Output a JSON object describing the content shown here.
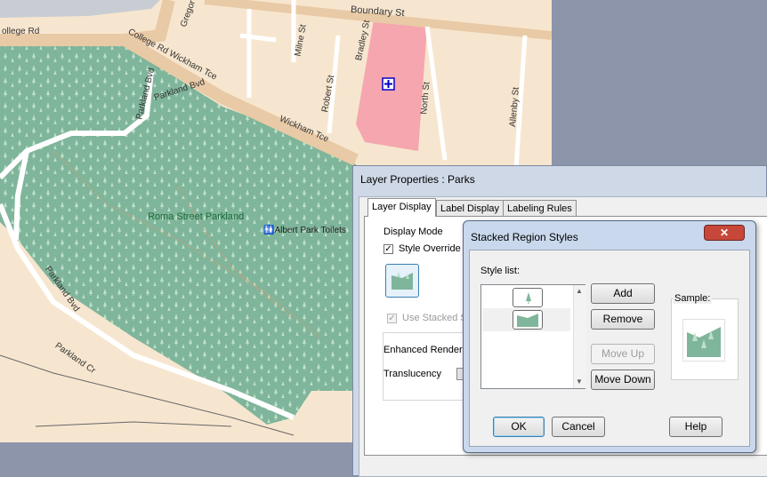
{
  "map": {
    "streets": {
      "boundary": "Boundary St",
      "gregory": "Gregor",
      "college_left": "ollege Rd",
      "college_wickham": "College Rd  Wickham Tce",
      "milne": "Milne St",
      "bradley": "Bradley St",
      "robert": "Robert St",
      "north": "North St",
      "allenby": "Allenby St",
      "parkland_bvd_upper": "Parkland Bvd",
      "parkland_bvd_lower": "Parkland Bvd",
      "wickham": "Wickham Tce",
      "parkland_cr": "Parkland Cr"
    },
    "park_name": "Roma Street Parkland",
    "toilets": "Albert Park Toilets",
    "colors": {
      "land": "#f7e6cf",
      "park": "#7fb59a",
      "hospital": "#f6a6ae",
      "road": "#f2d7b5"
    }
  },
  "layer_window": {
    "title": "Layer Properties  : Parks",
    "tabs": [
      "Layer Display",
      "Label Display",
      "Labeling Rules"
    ],
    "active_tab": "Layer Display",
    "display_mode_label": "Display Mode",
    "style_override_label": "Style Override",
    "style_override_checked": true,
    "use_stacked_label": "Use Stacked S",
    "use_stacked_checked": true,
    "enhanced_rendering_label": "Enhanced Renderin",
    "translucency_label": "Translucency"
  },
  "dialog": {
    "title": "Stacked Region Styles",
    "close_glyph": "✕",
    "style_list_label": "Style list:",
    "sample_label": "Sample:",
    "buttons": {
      "add": "Add",
      "remove": "Remove",
      "move_up": "Move Up",
      "move_down": "Move Down",
      "ok": "OK",
      "cancel": "Cancel",
      "help": "Help"
    },
    "icons": [
      "tree-symbol-icon",
      "region-fill-icon"
    ]
  }
}
